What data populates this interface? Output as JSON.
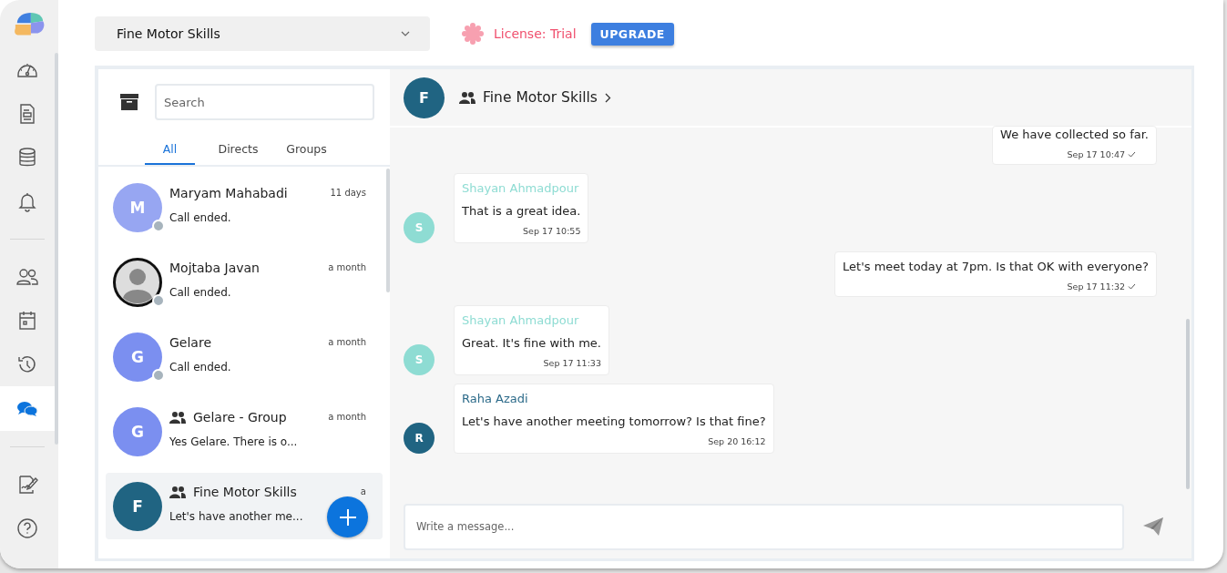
{
  "nav": [
    {
      "selected": false
    },
    {
      "selected": false
    },
    {
      "selected": false
    },
    {
      "selected": false
    },
    {
      "selected": false
    },
    {
      "selected": false
    },
    {
      "selected": false
    },
    {
      "selected": true
    },
    {
      "selected": false
    }
  ],
  "project_select": {
    "value": "Fine Motor Skills"
  },
  "license": {
    "label": "License: Trial",
    "button": "UPGRADE"
  },
  "search": {
    "placeholder": "Search"
  },
  "tabs": [
    {
      "label": "All",
      "selected": true
    },
    {
      "label": "Directs",
      "selected": false
    },
    {
      "label": "Groups",
      "selected": false
    }
  ],
  "conversations": [
    {
      "avatar": "M",
      "kind": "letter",
      "color": "#97a6f2",
      "name": "Maryam Mahabadi",
      "group": false,
      "time": "11 days",
      "preview": "Call ended.",
      "offline": true,
      "selected": false
    },
    {
      "kind": "picture",
      "name": "Mojtaba Javan",
      "group": false,
      "time": "a month",
      "preview": "Call ended.",
      "offline": true,
      "selected": false
    },
    {
      "avatar": "G",
      "kind": "letter",
      "color": "#7b8ff0",
      "name": "Gelare",
      "group": false,
      "time": "a month",
      "preview": "Call ended.",
      "offline": true,
      "selected": false
    },
    {
      "avatar": "G",
      "kind": "letter",
      "color": "#7b8ff0",
      "name": "Gelare - Group",
      "group": true,
      "time": "a month",
      "preview": "Yes Gelare. There is o...",
      "offline": false,
      "selected": false
    },
    {
      "avatar": "F",
      "kind": "letter",
      "color": "#206482",
      "name": "Fine Motor Skills",
      "group": true,
      "time": "a",
      "preview": "Let's have another me...",
      "offline": false,
      "selected": true
    }
  ],
  "chat_header": {
    "avatar": "F",
    "title": "Fine Motor Skills"
  },
  "messages": [
    {
      "kind": "outgoing",
      "text": "We have collected so far.",
      "time": "Sep 17 10:47",
      "read": true
    },
    {
      "kind": "incoming",
      "sender": "Shayan Ahmadpour",
      "avatar": "S",
      "color": "#8edcd3",
      "text": "That is a great idea.",
      "time": "Sep 17 10:55"
    },
    {
      "kind": "outgoing",
      "text": "Let's meet today at 7pm. Is that OK with everyone?",
      "time": "Sep 17 11:32",
      "read": true
    },
    {
      "kind": "incoming",
      "sender": "Shayan Ahmadpour",
      "avatar": "S",
      "color": "#8edcd3",
      "text": "Great. It's fine with me.",
      "time": "Sep 17 11:33"
    },
    {
      "kind": "incoming",
      "sender": "Raha Azadi",
      "avatar": "R",
      "color": "#206482",
      "text": "Let's have another meeting tomorrow? Is that fine?",
      "time": "Sep 20 16:12"
    }
  ],
  "composer": {
    "placeholder": "Write a message..."
  }
}
